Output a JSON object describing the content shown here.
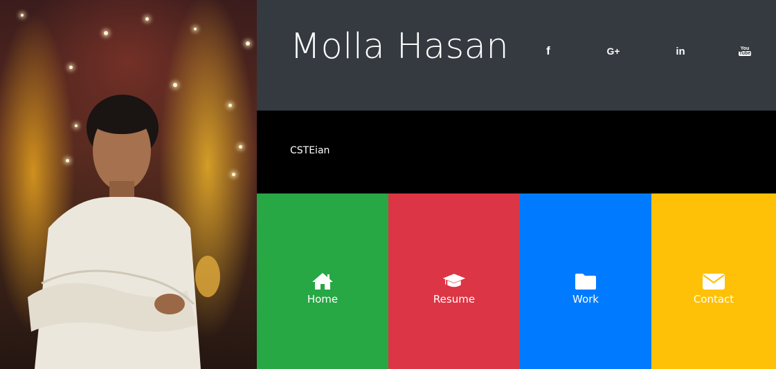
{
  "profile": {
    "name": "Molla Hasan",
    "tagline": "CSTEian"
  },
  "social": [
    {
      "icon": "facebook-icon",
      "glyph": "f"
    },
    {
      "icon": "google-plus-icon",
      "glyph": "G+"
    },
    {
      "icon": "linkedin-icon",
      "glyph": "in"
    },
    {
      "icon": "youtube-icon",
      "glyph": "You\nTube"
    }
  ],
  "nav": [
    {
      "label": "Home",
      "icon": "home-icon",
      "color": "#28a745"
    },
    {
      "label": "Resume",
      "icon": "graduation-cap-icon",
      "color": "#dc3545"
    },
    {
      "label": "Work",
      "icon": "folder-icon",
      "color": "#007bff"
    },
    {
      "label": "Contact",
      "icon": "envelope-icon",
      "color": "#ffc107"
    }
  ],
  "colors": {
    "header": "#343a40",
    "tagline_bar": "#000000"
  }
}
